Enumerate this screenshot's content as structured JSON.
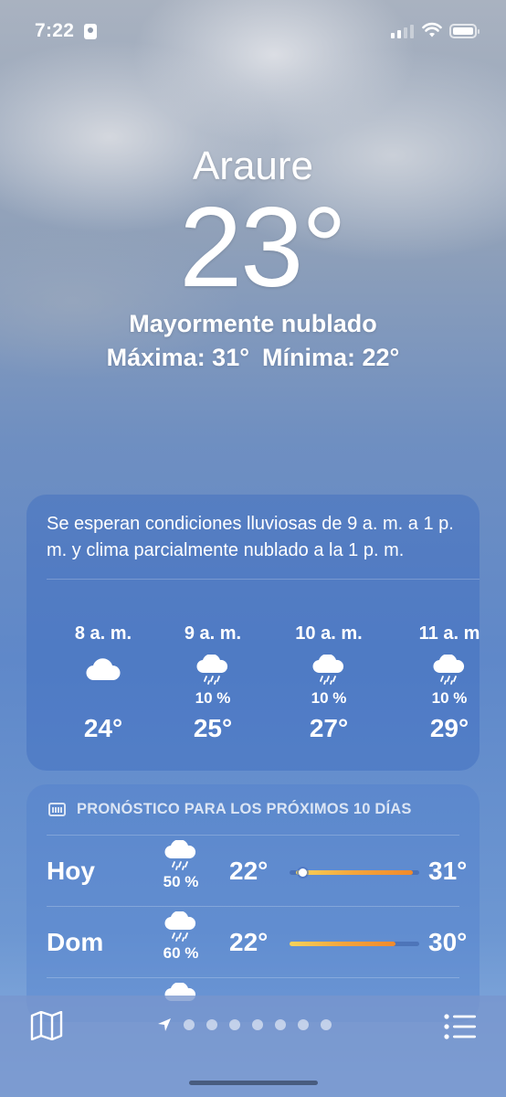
{
  "status_bar": {
    "time": "7:22"
  },
  "location": {
    "city": "Araure"
  },
  "current": {
    "temperature": "23°",
    "condition": "Mayormente nublado",
    "high": "Máxima: 31°",
    "low": "Mínima: 22°"
  },
  "hourly_card": {
    "summary": "Se esperan condiciones lluviosas de 9 a. m. a 1 p. m. y clima parcialmente nublado a la 1 p. m.",
    "hours": [
      {
        "label": "8 a. m.",
        "icon": "cloud-icon",
        "precip": "",
        "temp": "24°"
      },
      {
        "label": "9 a. m.",
        "icon": "cloud-rain-icon",
        "precip": "10 %",
        "temp": "25°"
      },
      {
        "label": "10 a. m.",
        "icon": "cloud-rain-icon",
        "precip": "10 %",
        "temp": "27°"
      },
      {
        "label": "11 a. m",
        "icon": "cloud-rain-icon",
        "precip": "10 %",
        "temp": "29°"
      }
    ]
  },
  "forecast_card": {
    "header": "PRONÓSTICO PARA LOS PRÓXIMOS 10 DÍAS",
    "days": [
      {
        "day": "Hoy",
        "icon": "cloud-rain-icon",
        "precip": "50 %",
        "low": "22°",
        "high": "31°",
        "range_start": 0.05,
        "range_end": 0.95,
        "current_marker": 0.1
      },
      {
        "day": "Dom",
        "icon": "cloud-rain-icon",
        "precip": "60 %",
        "low": "22°",
        "high": "30°",
        "range_start": 0.0,
        "range_end": 0.82
      }
    ]
  },
  "bottom_bar": {
    "left_icon": "map-icon",
    "right_icon": "list-icon",
    "page_dots": 7,
    "active_page": "location-arrow-icon"
  },
  "colors": {
    "bar_low": "#f6d35a",
    "bar_high": "#f08a2c"
  }
}
